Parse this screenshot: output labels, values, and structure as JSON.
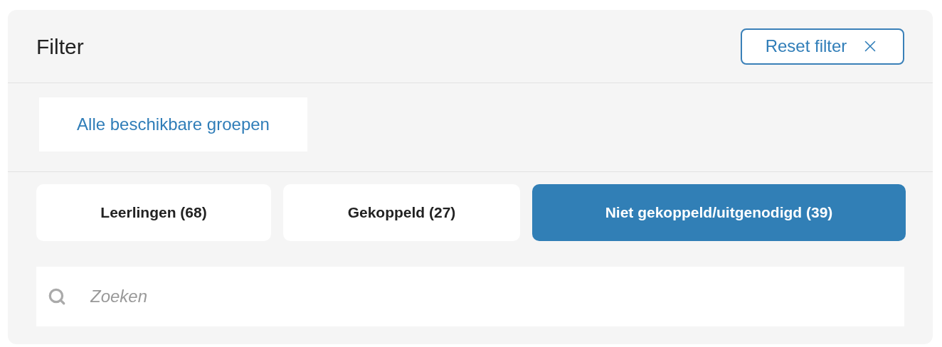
{
  "header": {
    "title": "Filter",
    "reset_button": "Reset filter"
  },
  "group_selector": {
    "label": "Alle beschikbare groepen"
  },
  "tabs": [
    {
      "label": "Leerlingen (68)",
      "selected": false
    },
    {
      "label": "Gekoppeld (27)",
      "selected": false
    },
    {
      "label": "Niet gekoppeld/uitgenodigd (39)",
      "selected": true
    }
  ],
  "search": {
    "placeholder": "Zoeken"
  }
}
